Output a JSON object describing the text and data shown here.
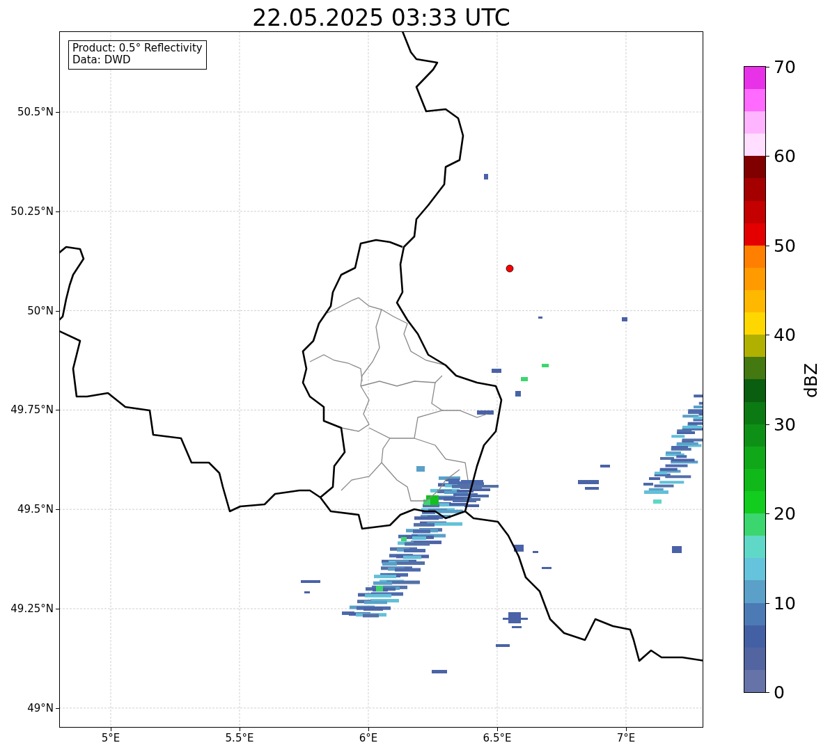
{
  "title": "22.05.2025 03:33 UTC",
  "map": {
    "legend": [
      "Product: 0.5° Reflectivity",
      "Data: DWD"
    ],
    "lat_ticks": [
      "50.5°N",
      "50.25°N",
      "50°N",
      "49.75°N",
      "49.5°N",
      "49.25°N",
      "49°N"
    ],
    "lon_ticks": [
      "5°E",
      "5.5°E",
      "6°E",
      "6.5°E",
      "7°E"
    ]
  },
  "colorbar": {
    "label": "dBZ",
    "ticks": [
      "70",
      "60",
      "50",
      "40",
      "30",
      "20",
      "10",
      "0"
    ],
    "bands": [
      {
        "color": "#6673a8"
      },
      {
        "color": "#5265a0"
      },
      {
        "color": "#4460a5"
      },
      {
        "color": "#4c7ab5"
      },
      {
        "color": "#5ba0c8"
      },
      {
        "color": "#65c3dc"
      },
      {
        "color": "#60d8c8"
      },
      {
        "color": "#3cd66e"
      },
      {
        "color": "#12cc1e"
      },
      {
        "color": "#10b81a"
      },
      {
        "color": "#10a818"
      },
      {
        "color": "#0e9016"
      },
      {
        "color": "#0c7a12"
      },
      {
        "color": "#0a5e10"
      },
      {
        "color": "#447810"
      },
      {
        "color": "#b0b000"
      },
      {
        "color": "#ffd700"
      },
      {
        "color": "#ffb800"
      },
      {
        "color": "#ff9a00"
      },
      {
        "color": "#ff7f00"
      },
      {
        "color": "#e40000"
      },
      {
        "color": "#c40000"
      },
      {
        "color": "#a40000"
      },
      {
        "color": "#800000"
      },
      {
        "color": "#ffdeff"
      },
      {
        "color": "#ffb4ff"
      },
      {
        "color": "#ff6aff"
      },
      {
        "color": "#e832e8"
      }
    ]
  }
}
